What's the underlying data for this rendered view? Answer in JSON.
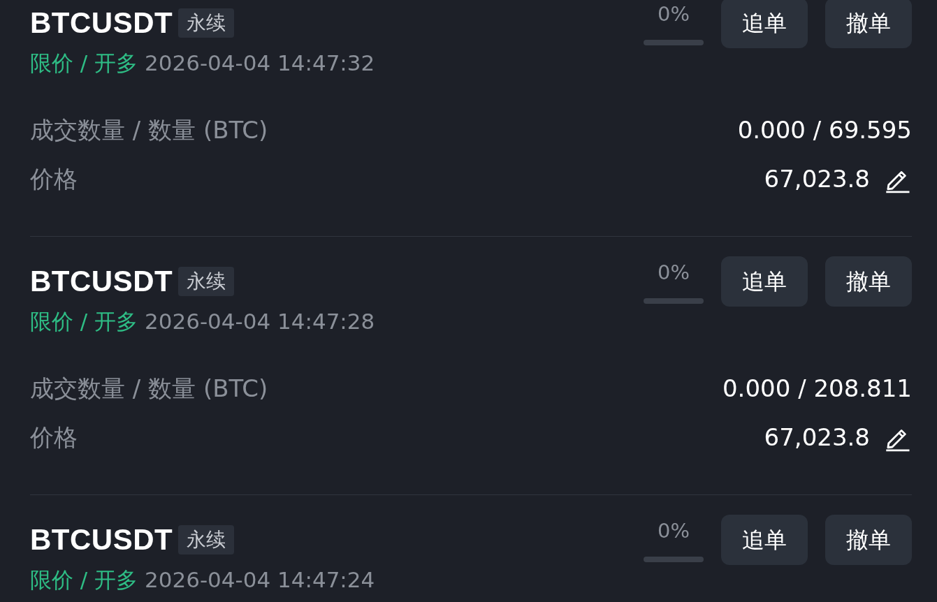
{
  "orders": [
    {
      "symbol": "BTCUSDT",
      "tag": "永续",
      "order_type": "限价 / 开多",
      "time": "2026-04-04 14:47:32",
      "progress_text": "0%",
      "level": 0,
      "buttons": [
        "追单",
        "撤单"
      ],
      "fields": [
        {
          "label": "成交数量 / 数量 (BTC)",
          "value": "0.000 / 69.595",
          "editable": false
        },
        {
          "label": "价格",
          "value": "67,023.8",
          "editable": true
        }
      ]
    },
    {
      "symbol": "BTCUSDT",
      "tag": "永续",
      "order_type": "限价 / 开多",
      "time": "2026-04-04 14:47:28",
      "progress_text": "0%",
      "level": 0,
      "buttons": [
        "追单",
        "撤单"
      ],
      "fields": [
        {
          "label": "成交数量 / 数量 (BTC)",
          "value": "0.000 / 208.811",
          "editable": false
        },
        {
          "label": "价格",
          "value": "67,023.8",
          "editable": true
        }
      ]
    },
    {
      "symbol": "BTCUSDT",
      "tag": "永续",
      "order_type": "限价 / 开多",
      "time": "2026-04-04 14:47:24",
      "progress_text": "0%",
      "level": 0,
      "buttons": [
        "追单",
        "撤单"
      ]
    }
  ]
}
